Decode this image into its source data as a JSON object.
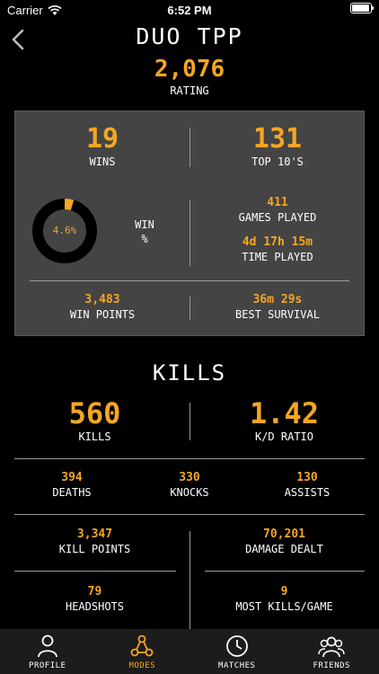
{
  "status": {
    "carrier": "Carrier",
    "time": "6:52 PM"
  },
  "header": {
    "title": "DUO TPP"
  },
  "rating": {
    "value": "2,076",
    "label": "RATING"
  },
  "summary": {
    "wins": {
      "value": "19",
      "label": "WINS"
    },
    "top10": {
      "value": "131",
      "label": "TOP 10'S"
    },
    "win_pct": {
      "value": "4.6%",
      "label_line1": "WIN",
      "label_line2": "%",
      "fraction": 0.046
    },
    "games_played": {
      "value": "411",
      "label": "GAMES PLAYED"
    },
    "time_played": {
      "value": "4d 17h 15m",
      "label": "TIME PLAYED"
    },
    "win_points": {
      "value": "3,483",
      "label": "WIN POINTS"
    },
    "best_survival": {
      "value": "36m 29s",
      "label": "BEST SURVIVAL"
    }
  },
  "kills_section": {
    "title": "KILLS",
    "kills": {
      "value": "560",
      "label": "KILLS"
    },
    "kd": {
      "value": "1.42",
      "label": "K/D RATIO"
    },
    "deaths": {
      "value": "394",
      "label": "DEATHS"
    },
    "knocks": {
      "value": "330",
      "label": "KNOCKS"
    },
    "assists": {
      "value": "130",
      "label": "ASSISTS"
    },
    "kill_points": {
      "value": "3,347",
      "label": "KILL POINTS"
    },
    "damage_dealt": {
      "value": "70,201",
      "label": "DAMAGE DEALT"
    },
    "headshots": {
      "value": "79",
      "label": "HEADSHOTS"
    },
    "most_kills": {
      "value": "9",
      "label": "MOST KILLS/GAME"
    }
  },
  "tabs": [
    {
      "label": "PROFILE",
      "icon": "person-icon",
      "active": false
    },
    {
      "label": "MODES",
      "icon": "network-icon",
      "active": true
    },
    {
      "label": "MATCHES",
      "icon": "clock-icon",
      "active": false
    },
    {
      "label": "FRIENDS",
      "icon": "group-icon",
      "active": false
    }
  ],
  "colors": {
    "accent": "#f5a623",
    "panel": "#444444",
    "background": "#000000",
    "tabbar": "#1c1c1c"
  }
}
